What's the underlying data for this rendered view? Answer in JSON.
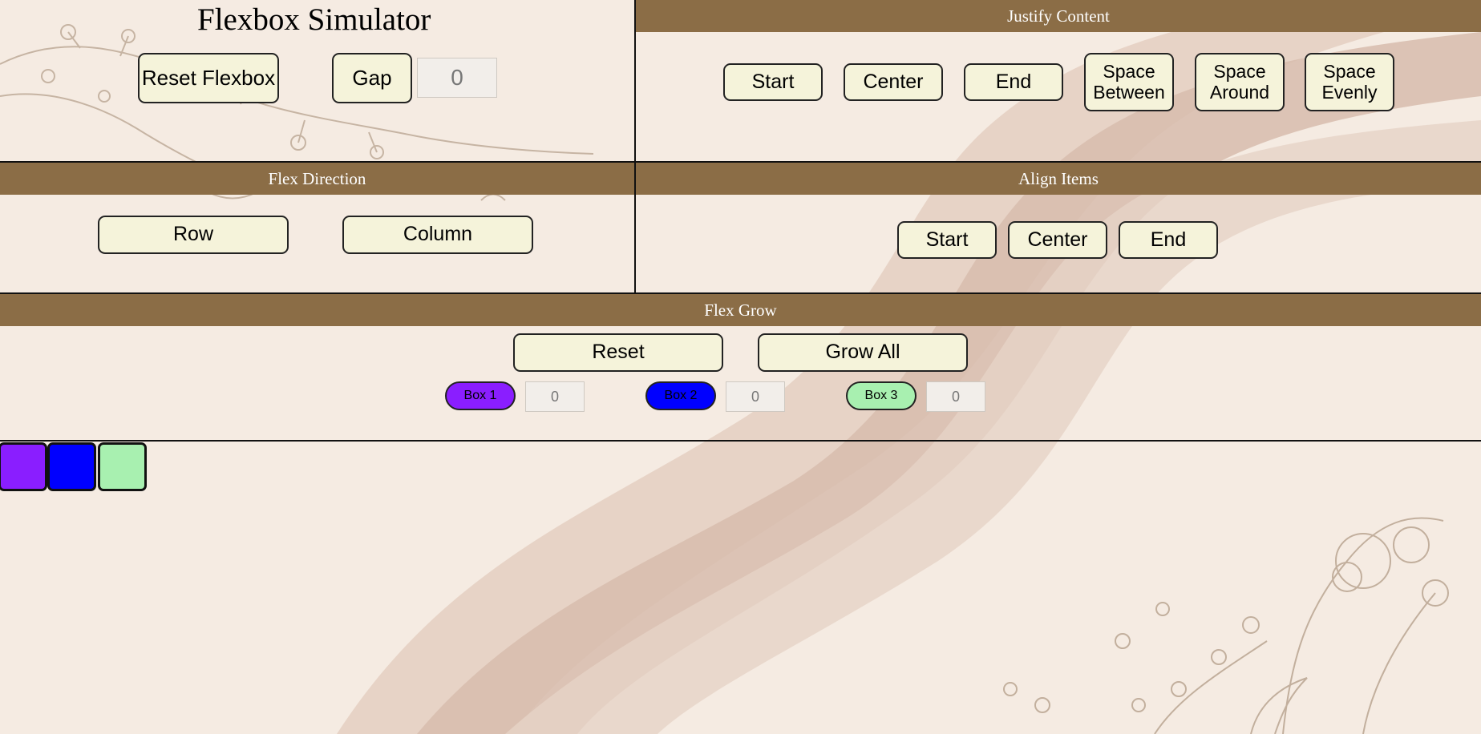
{
  "app": {
    "title": "Flexbox Simulator"
  },
  "controls": {
    "reset_flexbox_label": "Reset Flexbox",
    "gap_label": "Gap",
    "gap_value": "0"
  },
  "justify_content": {
    "title": "Justify Content",
    "buttons": [
      "Start",
      "Center",
      "End",
      "Space Between",
      "Space Around",
      "Space Evenly"
    ]
  },
  "flex_direction": {
    "title": "Flex Direction",
    "buttons": [
      "Row",
      "Column"
    ]
  },
  "align_items": {
    "title": "Align Items",
    "buttons": [
      "Start",
      "Center",
      "End"
    ]
  },
  "flex_grow": {
    "title": "Flex Grow",
    "reset_label": "Reset",
    "grow_all_label": "Grow All",
    "boxes": [
      {
        "label": "Box 1",
        "value": "0",
        "color": "#8a1eff"
      },
      {
        "label": "Box 2",
        "value": "0",
        "color": "#0000ff"
      },
      {
        "label": "Box 3",
        "value": "0",
        "color": "#a8f0b0"
      }
    ]
  },
  "colors": {
    "background": "#f5ebe2",
    "header": "#8b6d46",
    "button": "#f5f3da",
    "stripe": "#d9bfae"
  }
}
